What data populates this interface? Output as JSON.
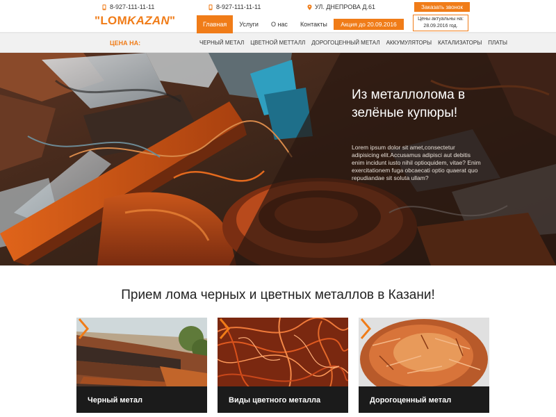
{
  "header": {
    "phone_1": "8-927-111-11-11",
    "phone_2": "8-927-111-11-11",
    "address": "УЛ. ДНЕПРОВА Д.61",
    "callback_label": "Заказать звонок",
    "prices_box_line1": "Цены актуальны на:",
    "prices_box_line2": "28.09.2016 год.",
    "logo_quote_open": "\"",
    "logo_lom": "LOM",
    "logo_kazan": "KAZAN",
    "logo_quote_close": "\"",
    "nav": [
      {
        "label": "Главная",
        "active": true
      },
      {
        "label": "Услуги",
        "active": false
      },
      {
        "label": "О нас",
        "active": false
      },
      {
        "label": "Контакты",
        "active": false
      }
    ],
    "promo_label": "Акция до 20.09.2016"
  },
  "pricebar": {
    "title": "ЦЕНА НА:",
    "links": [
      "ЧЕРНЫЙ МЕТАЛ",
      "ЦВЕТНОЙ МЕТТАЛЛ",
      "ДОРОГОЦЕННЫЙ МЕТАЛ",
      "АККУМУЛЯТОРЫ",
      "КАТАЛИЗАТОРЫ",
      "ПЛАТЫ"
    ]
  },
  "hero": {
    "title": "Из металлолома в зелёные купюры!",
    "text": "Lorem ipsum dolor sit amet,consectetur adipisicing elit.Accusamus adipisci aut debitis enim incidunt iusto nihil optioquidem, vitae? Enim exercitationem fuga obcaecati optio quaerat quo repudiandae sit soluta ullam?"
  },
  "services": {
    "title": "Прием лома черных и цветных металлов в Казани!",
    "cards": [
      {
        "label": "Черный метал"
      },
      {
        "label": "Виды цветного металла"
      },
      {
        "label": "Дорогоценный метал"
      }
    ]
  },
  "colors": {
    "accent": "#f07c18",
    "dark": "#1b1b1b",
    "pricebar_bg": "#f1f1f1"
  },
  "icons": [
    "phone-icon",
    "map-pin-icon",
    "chevron-right-icon"
  ]
}
